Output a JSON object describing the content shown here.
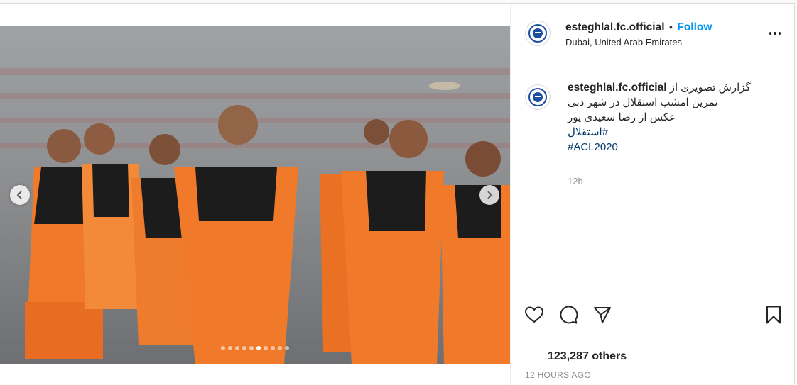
{
  "post": {
    "account": "esteghlal.fc.official",
    "separator": "•",
    "follow_label": "Follow",
    "location": "Dubai, United Arab Emirates",
    "caption_lines": [
      "گزارش تصویری از",
      "تمرین امشب استقلال در شهر دبی",
      "عکس از رضا سعیدی پور"
    ],
    "hashtags": [
      "#استقلال",
      "#ACL2020"
    ],
    "relative_time": "12h",
    "likes_text": "123,287 others",
    "timestamp": "12 HOURS AGO",
    "carousel": {
      "slide_count": 10,
      "active_index": 5
    }
  },
  "icons": {
    "prev": "chevron-left-icon",
    "next": "chevron-right-icon",
    "like": "heart-icon",
    "comment": "comment-icon",
    "share": "share-icon",
    "save": "bookmark-icon",
    "more": "more-options-icon"
  },
  "colors": {
    "accent": "#0095f6",
    "hashtag": "#00376b",
    "jersey": "#f07a2a",
    "bib": "#1c1c1c"
  }
}
